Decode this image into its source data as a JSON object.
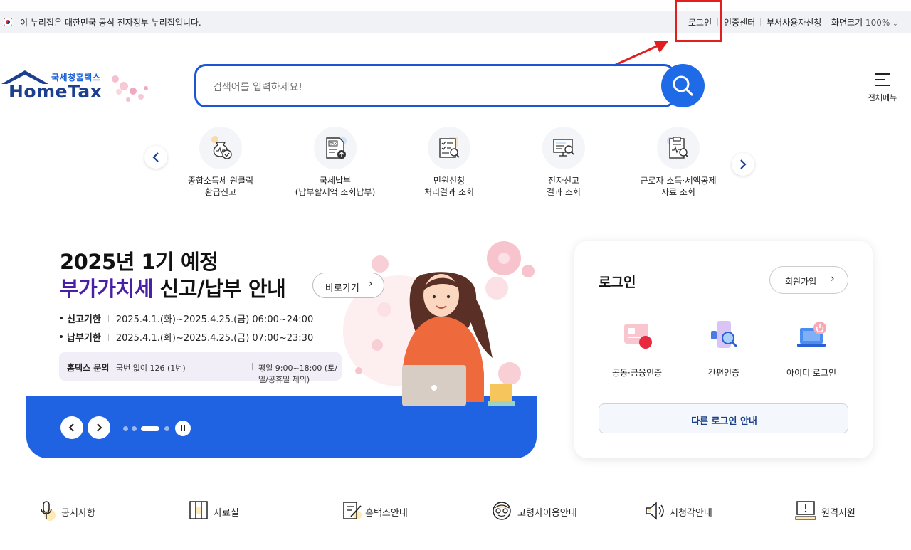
{
  "govbar": {
    "notice": "이 누리집은 대한민국 공식 전자정부 누리집입니다.",
    "login": "로그인",
    "cert_center": "인증센터",
    "dept_apply": "부서사용자신청",
    "zoom_label": "화면크기",
    "zoom_value": "100%"
  },
  "header": {
    "logo_small": "국세청홈택스",
    "logo_big": "HomeTax",
    "search_placeholder": "검색어를 입력하세요!",
    "allmenu_label": "전체메뉴"
  },
  "quick_menu": [
    {
      "line1": "종합소득세 원클릭",
      "line2": "환급신고",
      "icon": "money-bag-check-icon"
    },
    {
      "line1": "국세납부",
      "line2": "(납부할세액 조회납부)",
      "icon": "tax-document-icon"
    },
    {
      "line1": "민원신청",
      "line2": "처리결과 조회",
      "icon": "document-search-icon"
    },
    {
      "line1": "전자신고",
      "line2": "결과 조회",
      "icon": "monitor-search-icon"
    },
    {
      "line1": "근로자 소득·세액공제",
      "line2": "자료 조회",
      "icon": "clipboard-search-icon"
    }
  ],
  "banner": {
    "title_line1": "2025년 1기 예정",
    "title_hl": "부가가치세",
    "title_rest": " 신고/납부 안내",
    "goto_label": "바로가기",
    "rows": [
      {
        "key": "신고기한",
        "value": "2025.4.1.(화)~2025.4.25.(금) 06:00~24:00"
      },
      {
        "key": "납부기한",
        "value": "2025.4.1.(화)~2025.4.25.(금) 07:00~23:30"
      }
    ],
    "inquiry_key": "홈택스 문의",
    "inquiry_phone": "국번 없이 126 (1번)",
    "inquiry_hours": "평일 9:00~18:00 (토/일/공휴일 제외)",
    "slide_index": 3,
    "slide_count": 4
  },
  "login_panel": {
    "title": "로그인",
    "join_label": "회원가입",
    "options": [
      {
        "label": "공동·금융인증",
        "icon": "certificate-card-icon"
      },
      {
        "label": "간편인증",
        "icon": "phone-search-icon"
      },
      {
        "label": "아이디 로그인",
        "icon": "laptop-power-icon"
      }
    ],
    "other_label": "다른 로그인 안내"
  },
  "bottom_links": [
    {
      "label": "공지사항",
      "icon": "microphone-icon"
    },
    {
      "label": "자료실",
      "icon": "archive-icon"
    },
    {
      "label": "홈택스안내",
      "icon": "edit-document-icon"
    },
    {
      "label": "고령자이용안내",
      "icon": "senior-icon"
    },
    {
      "label": "시청각안내",
      "icon": "speaker-icon"
    },
    {
      "label": "원격지원",
      "icon": "remote-support-icon"
    }
  ],
  "colors": {
    "brand_blue": "#1f62e2",
    "search_border": "#1b56d4",
    "highlight_red": "#e0201f",
    "title_purple": "#4a1fa8"
  }
}
